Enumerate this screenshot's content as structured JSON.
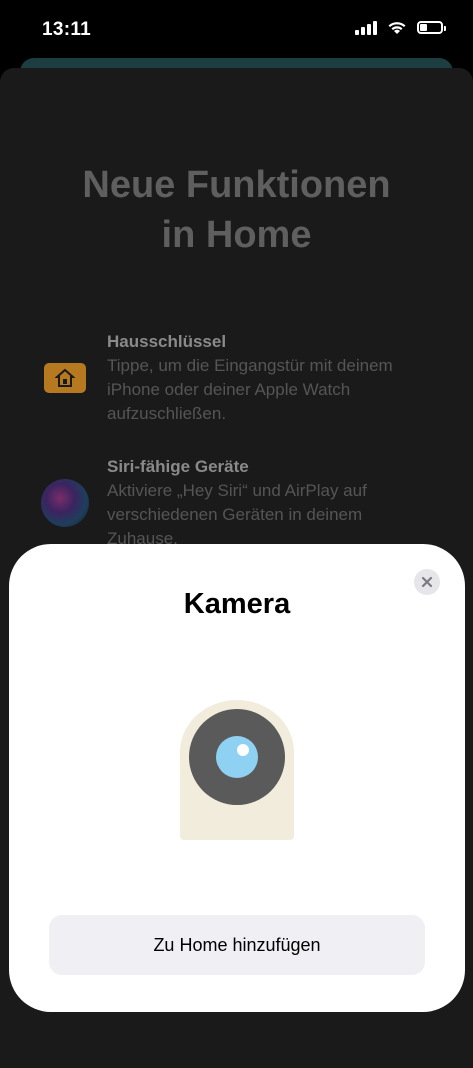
{
  "status_bar": {
    "time": "13:11",
    "battery_level": 0.35
  },
  "background": {
    "title_line1": "Neue Funktionen",
    "title_line2": "in Home",
    "features": [
      {
        "title": "Hausschlüssel",
        "desc_lines": [
          "Tippe, um die Eingangstür mit deinem",
          "iPhone oder deiner Apple Watch",
          "aufzuschließen."
        ],
        "icon": "house-key-icon"
      },
      {
        "title": "Siri-fähige Geräte",
        "desc_lines": [
          "Aktiviere „Hey Siri“ und AirPlay auf",
          "verschiedenen Geräten in deinem",
          "Zuhause."
        ],
        "icon": "siri-icon"
      }
    ]
  },
  "modal": {
    "title": "Kamera",
    "add_button_label": "Zu Home hinzufügen",
    "close_icon": "close-icon",
    "device_icon": "camera-icon"
  },
  "colors": {
    "accent_stub": "#1c3e40",
    "key_icon": "#b7791f",
    "camera_body": "#f1ecdc",
    "camera_lens": "#5a5a5a",
    "camera_glass": "#8fd1f2"
  }
}
